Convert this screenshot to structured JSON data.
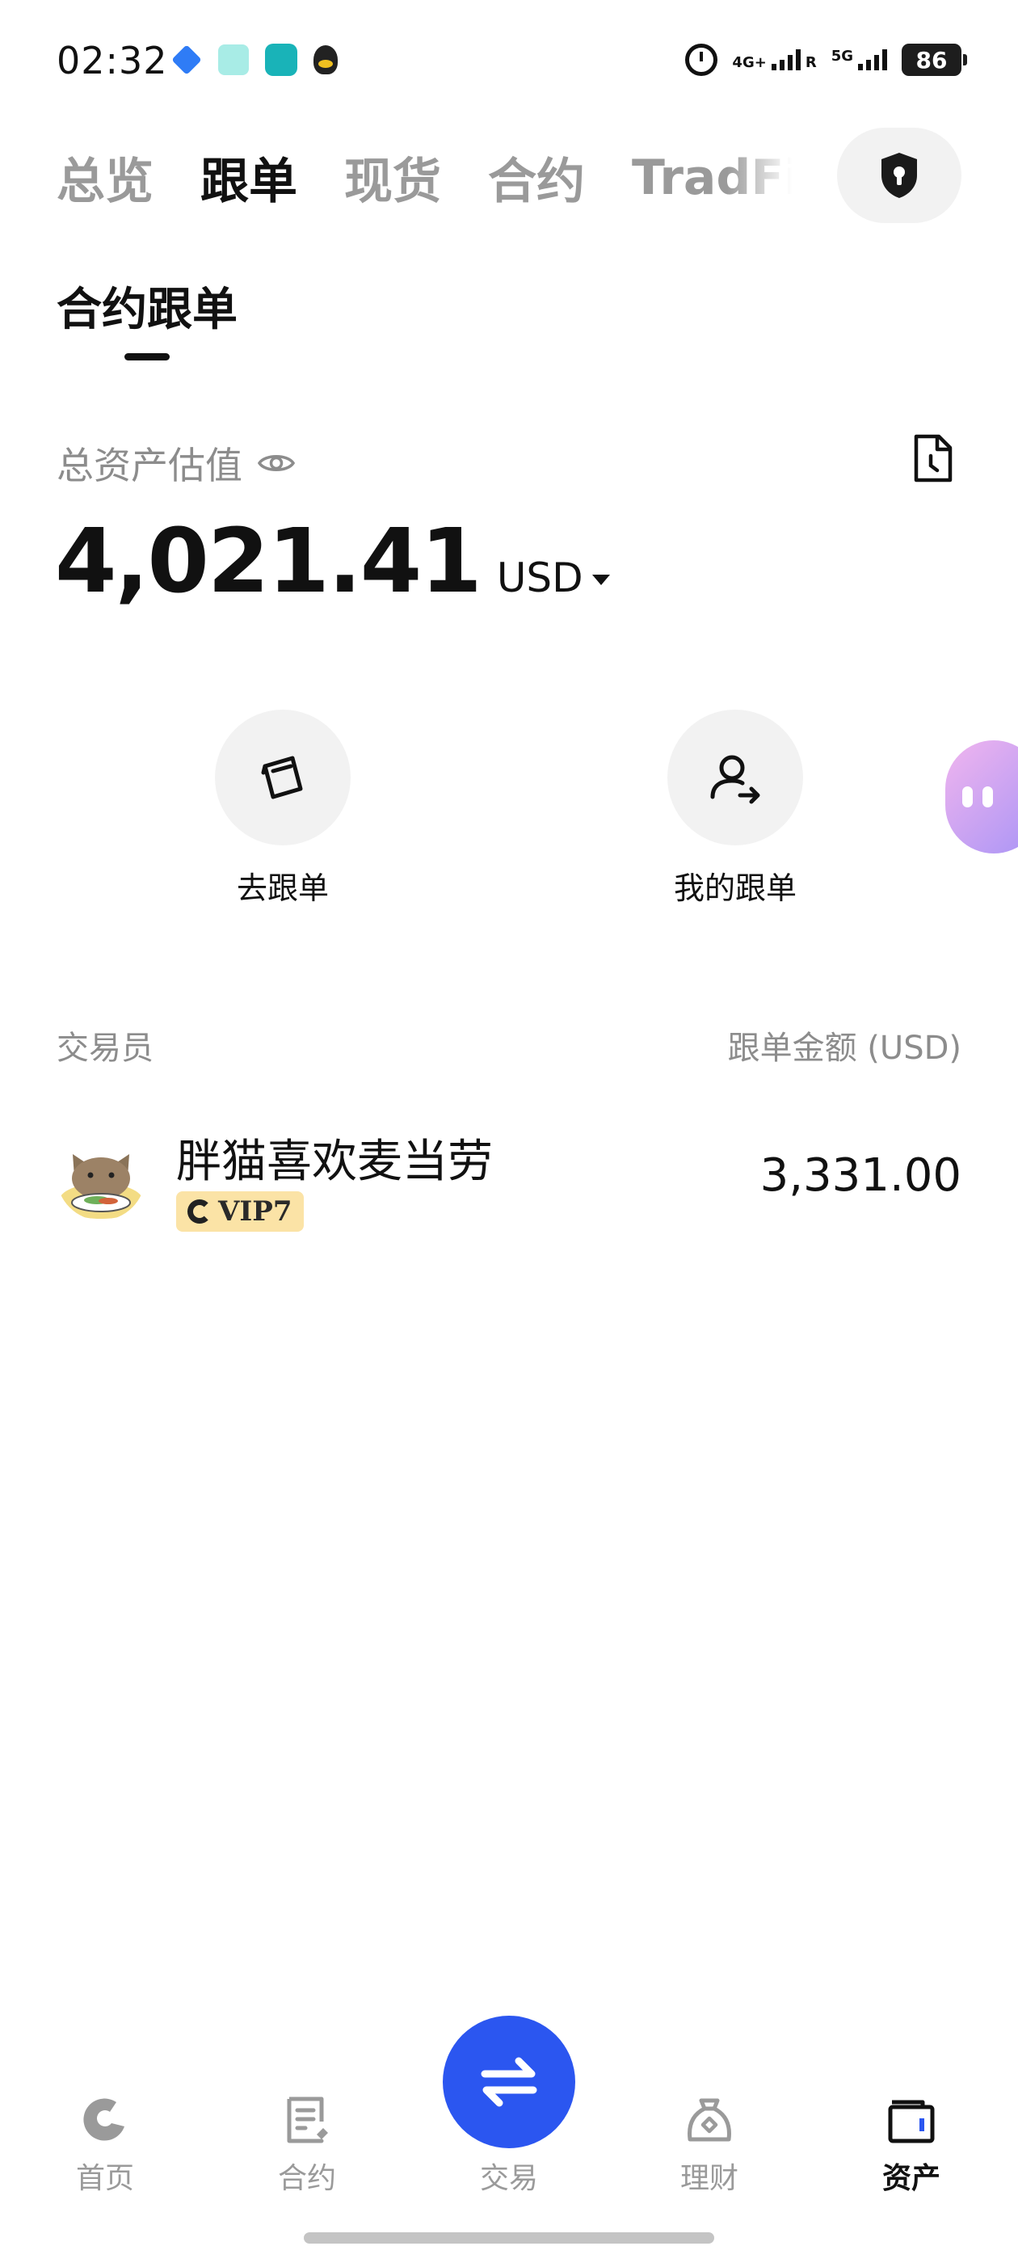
{
  "status_bar": {
    "time": "02:32",
    "network_1": "4G+",
    "network_1_sub": "R",
    "network_2": "5G",
    "battery": "86",
    "notification_icons": [
      "cube-app-icon",
      "message-app-icon",
      "teal-app-icon",
      "qq-penguin-icon"
    ]
  },
  "top_tabs": [
    {
      "label": "总览",
      "active": false
    },
    {
      "label": "跟单",
      "active": true
    },
    {
      "label": "现货",
      "active": false
    },
    {
      "label": "合约",
      "active": false
    },
    {
      "label": "TradFi",
      "active": false
    }
  ],
  "sub_tab": {
    "label": "合约跟单"
  },
  "assets": {
    "label": "总资产估值",
    "amount": "4,021.41",
    "currency": "USD"
  },
  "actions": [
    {
      "label": "去跟单",
      "icon": "copy-trade-cards-icon"
    },
    {
      "label": "我的跟单",
      "icon": "user-arrow-icon"
    }
  ],
  "trader_list": {
    "header_left": "交易员",
    "header_right": "跟单金额 (USD)",
    "items": [
      {
        "name": "胖猫喜欢麦当劳",
        "vip": "VIP7",
        "amount": "3,331.00"
      }
    ]
  },
  "bottom_nav": [
    {
      "label": "首页",
      "icon": "home-icon",
      "active": false
    },
    {
      "label": "合约",
      "icon": "contract-icon",
      "active": false
    },
    {
      "label": "交易",
      "icon": "swap-arrows-icon",
      "active": false
    },
    {
      "label": "理财",
      "icon": "finance-icon",
      "active": false
    },
    {
      "label": "资产",
      "icon": "wallet-icon",
      "active": true
    }
  ],
  "colors": {
    "accent": "#2b56f0",
    "text_primary": "#111111",
    "text_secondary": "#8c8c8c",
    "vip_badge_bg": "#fbe3a6",
    "assistant_gradient_start": "#f1b5ee",
    "assistant_gradient_end": "#a894f6"
  }
}
